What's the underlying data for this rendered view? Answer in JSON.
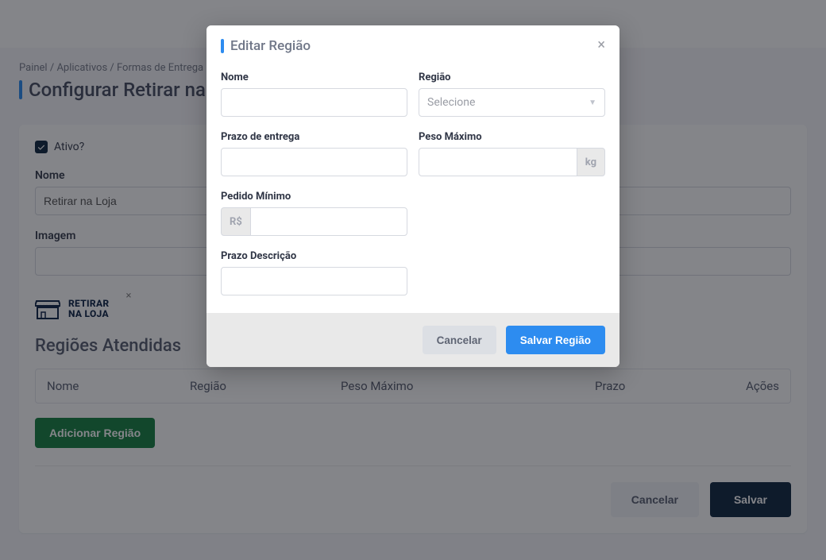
{
  "breadcrumb": {
    "item1": "Painel",
    "item2": "Aplicativos",
    "item3": "Formas de Entrega"
  },
  "page_title": "Configurar Retirar na Loja",
  "form": {
    "active_label": "Ativo?",
    "nome_label": "Nome",
    "nome_value": "Retirar na Loja",
    "imagem_label": "Imagem",
    "thumb_line1": "RETIRAR",
    "thumb_line2": "NA LOJA",
    "regions_title": "Regiões Atendidas"
  },
  "table": {
    "col_nome": "Nome",
    "col_regiao": "Região",
    "col_peso": "Peso Máximo",
    "col_prazo": "Prazo",
    "col_acoes": "Ações"
  },
  "buttons": {
    "add_region": "Adicionar Região",
    "cancel": "Cancelar",
    "save": "Salvar"
  },
  "modal": {
    "title": "Editar Região",
    "nome_label": "Nome",
    "regiao_label": "Região",
    "regiao_placeholder": "Selecione",
    "prazo_label": "Prazo de entrega",
    "peso_label": "Peso Máximo",
    "peso_suffix": "kg",
    "pedido_label": "Pedido Mínimo",
    "pedido_prefix": "R$",
    "prazo_desc_label": "Prazo Descrição",
    "cancel": "Cancelar",
    "save": "Salvar Região"
  }
}
